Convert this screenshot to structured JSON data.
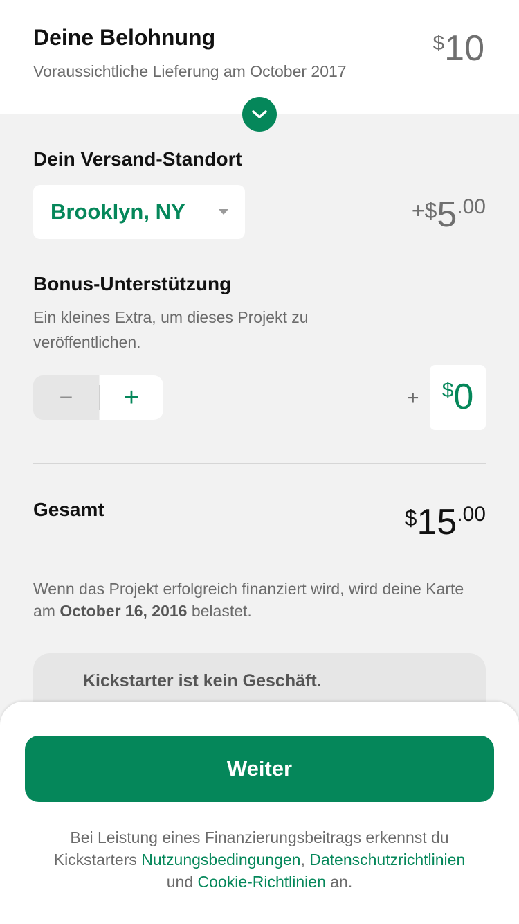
{
  "reward": {
    "title": "Deine Belohnung",
    "delivery": "Voraussichtliche Lieferung am October 2017",
    "currency": "$",
    "amount": "10"
  },
  "shipping": {
    "heading": "Dein Versand-Standort",
    "location": "Brooklyn, NY",
    "price_prefix": "+$",
    "price_whole": "5",
    "price_cents": ".00"
  },
  "bonus": {
    "heading": "Bonus-Unterstützung",
    "description": "Ein kleines Extra, um dieses Projekt zu veröffentlichen.",
    "minus_label": "−",
    "plus_label": "+",
    "plus_sign": "+",
    "currency": "$",
    "amount": "0"
  },
  "total": {
    "label": "Gesamt",
    "currency": "$",
    "whole": "15",
    "cents": ".00"
  },
  "charge_note": {
    "before": "Wenn das Projekt erfolgreich finanziert wird, wird deine Karte am ",
    "date": "October 16, 2016",
    "after": " belastet."
  },
  "info_card": {
    "title": "Kickstarter ist kein Geschäft."
  },
  "footer": {
    "continue_label": "Weiter",
    "legal_1": "Bei Leistung eines Finanzierungsbeitrags erkennst du Kickstarters ",
    "terms_link": "Nutzungsbedingungen",
    "legal_2": ", ",
    "privacy_link": "Datenschutzrichtlinien",
    "legal_3": " und ",
    "cookie_link": "Cookie-Richtlinien",
    "legal_4": " an."
  },
  "colors": {
    "accent": "#05875a",
    "background": "#f2f2f2"
  },
  "icons": {
    "collapse": "chevron-down-icon",
    "dropdown": "caret-down-icon"
  }
}
